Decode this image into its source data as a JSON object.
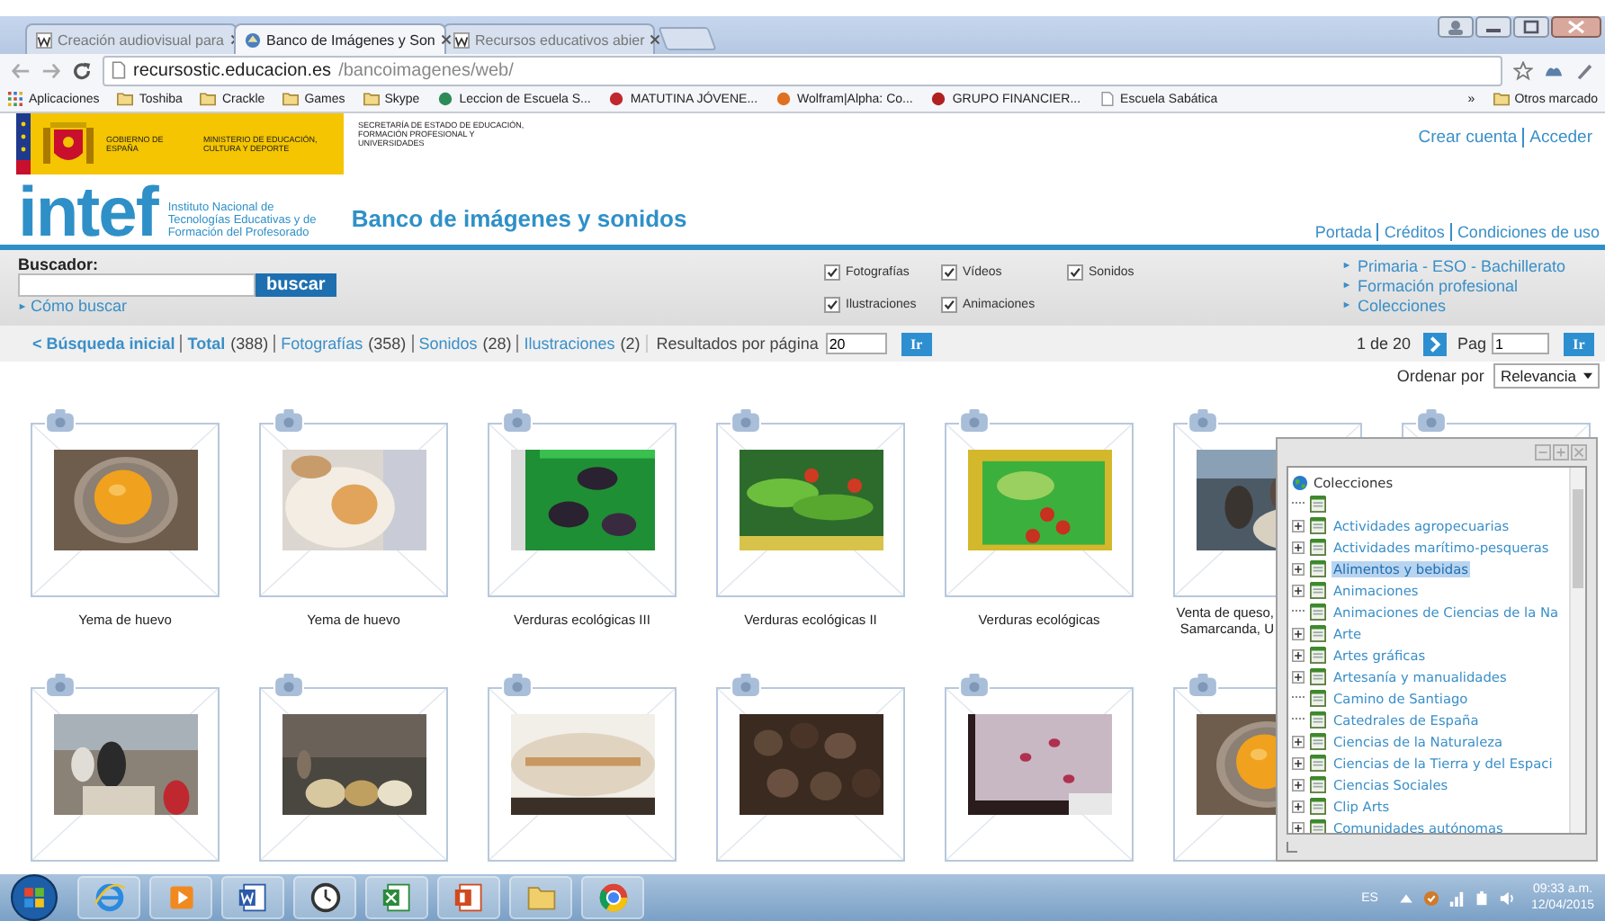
{
  "browser": {
    "tabs": [
      {
        "label": "Creación audiovisual para",
        "selected": false
      },
      {
        "label": "Banco de Imágenes y Son",
        "selected": true
      },
      {
        "label": "Recursos educativos abier",
        "selected": false
      }
    ],
    "url_host": "recursostic.educacion.es",
    "url_path": "/bancoimagenes/web/",
    "bookmarks": [
      {
        "label": "Aplicaciones",
        "kind": "apps"
      },
      {
        "label": "Toshiba",
        "kind": "folder"
      },
      {
        "label": "Crackle",
        "kind": "folder"
      },
      {
        "label": "Games",
        "kind": "folder"
      },
      {
        "label": "Skype",
        "kind": "folder"
      },
      {
        "label": "Leccion de Escuela S...",
        "kind": "site",
        "color": "#2e8b57"
      },
      {
        "label": "MATUTINA JÓVENE...",
        "kind": "site",
        "color": "#c0282d"
      },
      {
        "label": "Wolfram|Alpha: Co...",
        "kind": "site",
        "color": "#e07020"
      },
      {
        "label": "GRUPO FINANCIER...",
        "kind": "site",
        "color": "#b02020"
      },
      {
        "label": "Escuela Sabática",
        "kind": "page"
      },
      {
        "label": "»",
        "kind": "more"
      },
      {
        "label": "Otros marcado",
        "kind": "folder"
      }
    ]
  },
  "header": {
    "gov": "GOBIERNO DE ESPAÑA",
    "ministry": "MINISTERIO DE EDUCACIÓN, CULTURA Y DEPORTE",
    "secretariat": "SECRETARÍA DE ESTADO DE EDUCACIÓN, FORMACIÓN PROFESIONAL Y UNIVERSIDADES",
    "account_links": [
      "Crear cuenta",
      "Acceder"
    ],
    "logo": "intef",
    "institute": "Instituto Nacional de Tecnologías Educativas y de Formación del Profesorado",
    "site_title": "Banco de imágenes y sonidos",
    "nav_links": [
      "Portada",
      "Créditos",
      "Condiciones de uso"
    ]
  },
  "search": {
    "label": "Buscador:",
    "button": "buscar",
    "help_link": "Cómo buscar",
    "filters": [
      {
        "label": "Fotografías",
        "checked": true
      },
      {
        "label": "Vídeos",
        "checked": true
      },
      {
        "label": "Sonidos",
        "checked": true
      },
      {
        "label": "Ilustraciones",
        "checked": true
      },
      {
        "label": "Animaciones",
        "checked": true
      }
    ],
    "quick_links": [
      "Primaria - ESO - Bachillerato",
      "Formación profesional",
      "Colecciones"
    ]
  },
  "results": {
    "back_link": "< Búsqueda inicial",
    "counts": [
      {
        "label": "Total",
        "count": "(388)",
        "selected": true
      },
      {
        "label": "Fotografías",
        "count": "(358)",
        "selected": false
      },
      {
        "label": "Sonidos",
        "count": "(28)",
        "selected": false
      },
      {
        "label": "Ilustraciones",
        "count": "(2)",
        "selected": false
      }
    ],
    "per_page_label": "Resultados por página",
    "per_page": "20",
    "go": "Ir",
    "page_info": "1 de 20",
    "page_label": "Pag",
    "page": "1",
    "page_go": "Ir",
    "sort_label": "Ordenar por",
    "sort": "Relevancia"
  },
  "thumbnails": [
    {
      "kind": "picture",
      "caption": "Yema de huevo"
    },
    {
      "kind": "picture",
      "caption": "Yema de huevo"
    },
    {
      "kind": "picture",
      "caption": "Verduras ecológicas III"
    },
    {
      "kind": "picture",
      "caption": "Verduras ecológicas II"
    },
    {
      "kind": "picture",
      "caption": "Verduras ecológicas"
    },
    {
      "kind": "picture",
      "caption": "Venta de queso, Samarcanda, U"
    },
    {
      "kind": "covered"
    },
    {
      "kind": "picture"
    },
    {
      "kind": "picture"
    },
    {
      "kind": "picture"
    },
    {
      "kind": "picture"
    },
    {
      "kind": "picture"
    },
    {
      "kind": "picture"
    }
  ],
  "collections_panel": {
    "title": "Colecciones",
    "items": [
      {
        "expandable": false,
        "selected": false
      },
      {
        "label": "Actividades agropecuarias",
        "expandable": true,
        "selected": false
      },
      {
        "label": "Actividades marítimo-pesqueras",
        "expandable": true,
        "selected": false
      },
      {
        "label": "Alimentos y bebidas",
        "expandable": true,
        "selected": true
      },
      {
        "label": "Animaciones",
        "expandable": true,
        "selected": false
      },
      {
        "label": "Animaciones de Ciencias de la Na",
        "expandable": false,
        "selected": false
      },
      {
        "label": "Arte",
        "expandable": true,
        "selected": false
      },
      {
        "label": "Artes gráficas",
        "expandable": true,
        "selected": false
      },
      {
        "label": "Artesanía y manualidades",
        "expandable": true,
        "selected": false
      },
      {
        "label": "Camino de Santiago",
        "expandable": false,
        "selected": false
      },
      {
        "label": "Catedrales de España",
        "expandable": false,
        "selected": false
      },
      {
        "label": "Ciencias de la Naturaleza",
        "expandable": true,
        "selected": false
      },
      {
        "label": "Ciencias de la Tierra y del Espaci",
        "expandable": true,
        "selected": false
      },
      {
        "label": "Ciencias Sociales",
        "expandable": true,
        "selected": false
      },
      {
        "label": "Clip Arts",
        "expandable": true,
        "selected": false
      },
      {
        "label": "Comunidades autónomas",
        "expandable": true,
        "selected": false
      }
    ]
  },
  "taskbar": {
    "language": "ES",
    "time": "09:33 a.m.",
    "date": "12/04/2015"
  }
}
